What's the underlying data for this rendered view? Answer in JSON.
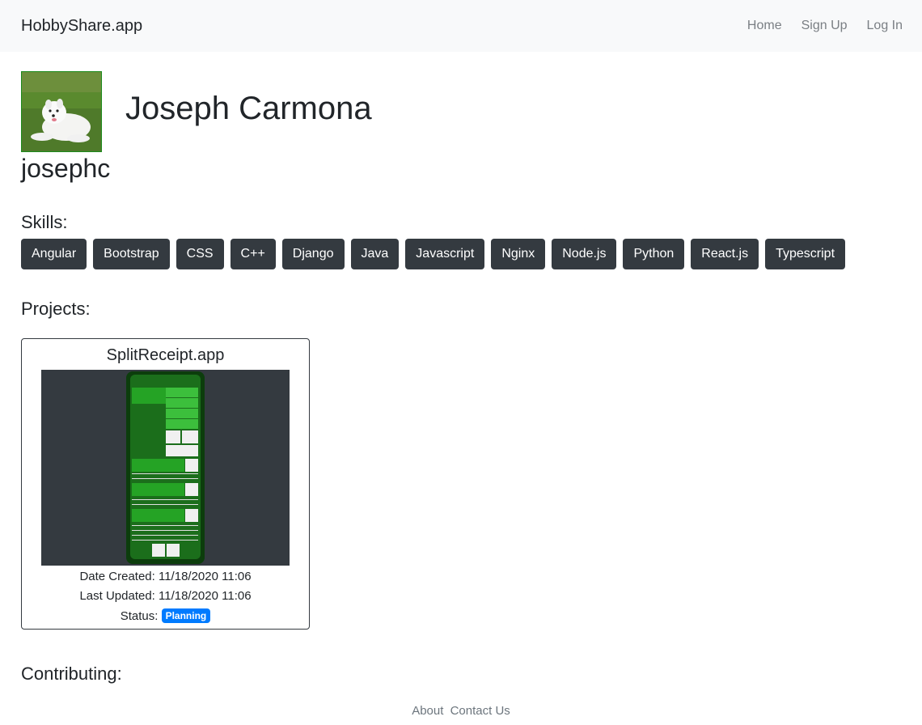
{
  "navbar": {
    "brand": "HobbyShare.app",
    "links": [
      "Home",
      "Sign Up",
      "Log In"
    ]
  },
  "profile": {
    "full_name": "Joseph Carmona",
    "username": "josephc"
  },
  "skills": {
    "title": "Skills:",
    "items": [
      "Angular",
      "Bootstrap",
      "CSS",
      "C++",
      "Django",
      "Java",
      "Javascript",
      "Nginx",
      "Node.js",
      "Python",
      "React.js",
      "Typescript"
    ]
  },
  "projects": {
    "title": "Projects:",
    "items": [
      {
        "name": "SplitReceipt.app",
        "date_created_label": "Date Created: 11/18/2020 11:06",
        "last_updated_label": "Last Updated: 11/18/2020 11:06",
        "status_label": "Status:",
        "status": "Planning"
      }
    ]
  },
  "contributing": {
    "title": "Contributing:"
  },
  "footer": {
    "links": [
      "About",
      "Contact Us"
    ]
  },
  "colors": {
    "dark": "#343a40",
    "badge": "#007bff",
    "navbar_bg": "#f8f9fa",
    "screenshot_green": "#1e8a1e"
  }
}
